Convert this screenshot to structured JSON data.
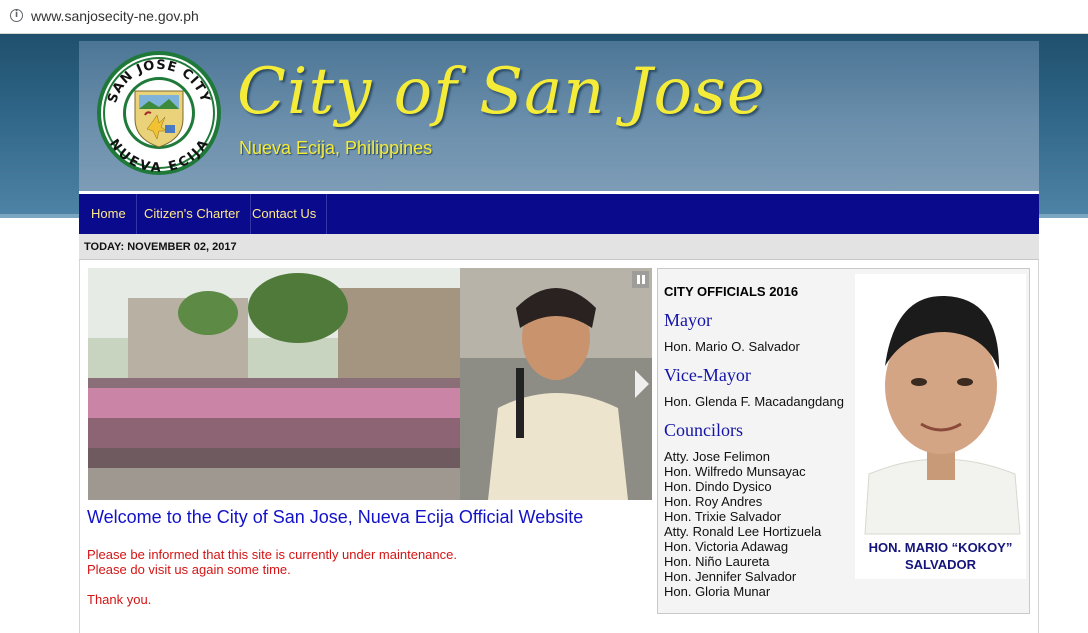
{
  "browser": {
    "url": "www.sanjosecity-ne.gov.ph",
    "info_icon": "info-circle-icon"
  },
  "header": {
    "title": "City of San Jose",
    "subtitle": "Nueva Ecija, Philippines",
    "seal": {
      "top_text": "SAN JOSE CITY",
      "bottom_text": "NUEVA ECIJA"
    }
  },
  "nav": {
    "items": [
      {
        "label": "Home"
      },
      {
        "label": "Citizen's Charter"
      },
      {
        "label": "Contact Us"
      }
    ]
  },
  "datebar": {
    "text": "TODAY: NOVEMBER 02, 2017"
  },
  "main": {
    "welcome": "Welcome to the City of San Jose, Nueva Ecija Official Website",
    "notice_line1": "Please be informed that this site is currently under maintenance.",
    "notice_line2": "Please do visit us again some time.",
    "thanks": "Thank you.",
    "slideshow": {
      "pause_icon": "pause-icon",
      "next_icon": "chevron-right-icon"
    }
  },
  "officials": {
    "title": "CITY OFFICIALS 2016",
    "mayor_heading": "Mayor",
    "mayor_name": "Hon. Mario O. Salvador",
    "vice_heading": "Vice-Mayor",
    "vice_name": "Hon. Glenda F. Macadangdang",
    "councilors_heading": "Councilors",
    "councilors": [
      "Atty. Jose Felimon",
      "Hon. Wilfredo Munsayac",
      "Hon. Dindo Dysico",
      "Hon. Roy Andres",
      "Hon. Trixie Salvador",
      "Atty. Ronald Lee Hortizuela",
      "Hon. Victoria Adawag",
      "Hon. Niño Laureta",
      "Hon. Jennifer Salvador",
      "Hon. Gloria Munar"
    ],
    "photo_caption_line1": "HON. MARIO “KOKOY”",
    "photo_caption_line2": "SALVADOR"
  },
  "colors": {
    "nav_bg": "#0a0a8c",
    "nav_text": "#ffe98a",
    "title_yellow": "#f4ec38",
    "heading_blue": "#1414a8",
    "notice_red": "#d41414"
  }
}
